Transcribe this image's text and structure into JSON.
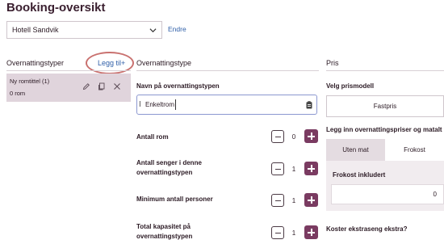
{
  "page": {
    "title": "Booking-oversikt"
  },
  "hotel": {
    "selected": "Hotell Sandvik",
    "edit_label": "Endre"
  },
  "room_types": {
    "heading": "Overnattingstyper",
    "add_label": "Legg til+",
    "items": [
      {
        "name": "Ny romtittel (1)",
        "count": "0 rom"
      }
    ]
  },
  "room_type_form": {
    "heading": "Overnattingstype",
    "name_label": "Navn på overnattingstypen",
    "name_value": "Enkeltrom",
    "steppers": [
      {
        "label_line1": "Antall rom",
        "label_line2": "",
        "value": "0"
      },
      {
        "label_line1": "Antall senger i denne",
        "label_line2": "overnattingstypen",
        "value": "1"
      },
      {
        "label_line1": "Minimum antall personer",
        "label_line2": "",
        "value": "1"
      },
      {
        "label_line1": "Total kapasitet på",
        "label_line2": "overnattingstypen",
        "value": "1"
      }
    ]
  },
  "price": {
    "heading": "Pris",
    "model_label": "Velg prismodell",
    "model_value": "Fastpris",
    "prices_label": "Legg inn overnattingspriser og matalt",
    "tabs": [
      "Uten mat",
      "Frokost"
    ],
    "breakfast_label": "Frokost inkludert",
    "breakfast_value": "0",
    "extra_bed_label": "Koster ekstraseng ekstra?"
  }
}
